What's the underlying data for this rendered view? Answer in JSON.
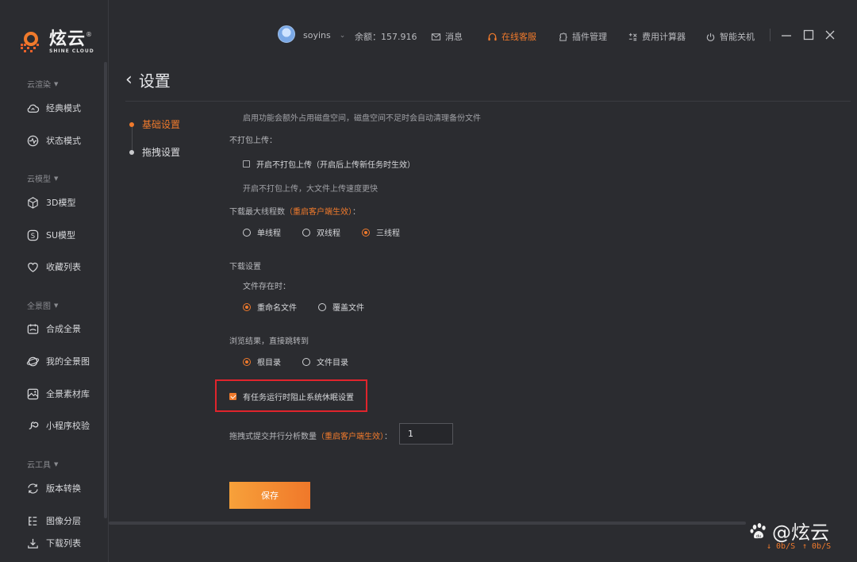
{
  "brand": {
    "name_cn": "炫云",
    "name_en": "SHINE CLOUD",
    "reg": "®"
  },
  "sidebar": {
    "groups": [
      {
        "label": "云渲染",
        "items": [
          {
            "label": "经典模式",
            "icon": "cloud-icon"
          },
          {
            "label": "状态模式",
            "icon": "status-icon"
          }
        ]
      },
      {
        "label": "云模型",
        "items": [
          {
            "label": "3D模型",
            "icon": "cube-icon"
          },
          {
            "label": "SU模型",
            "icon": "su-icon"
          },
          {
            "label": "收藏列表",
            "icon": "heart-icon"
          }
        ]
      },
      {
        "label": "全景图",
        "items": [
          {
            "label": "合成全景",
            "icon": "panorama-icon"
          },
          {
            "label": "我的全景图",
            "icon": "globe-icon"
          },
          {
            "label": "全景素材库",
            "icon": "image-library-icon"
          },
          {
            "label": "小程序校验",
            "icon": "miniprogram-icon"
          }
        ]
      },
      {
        "label": "云工具",
        "items": [
          {
            "label": "版本转换",
            "icon": "convert-icon"
          },
          {
            "label": "图像分层",
            "icon": "layers-icon"
          },
          {
            "label": "下载列表",
            "icon": "download-icon"
          }
        ]
      }
    ]
  },
  "topbar": {
    "username": "soyins",
    "balance_label": "余额：157.916",
    "messages": "消息",
    "support": "在线客服",
    "plugins": "插件管理",
    "calculator": "费用计算器",
    "shutdown": "智能关机"
  },
  "page": {
    "title": "设置"
  },
  "settings_nav": [
    {
      "label": "基础设置",
      "active": true
    },
    {
      "label": "拖拽设置",
      "active": false
    }
  ],
  "settings": {
    "backup_hint": "启用功能会额外占用磁盘空间，磁盘空间不足时会自动清理备份文件",
    "no_pack_title": "不打包上传：",
    "no_pack_option": "开启不打包上传（开启后上传新任务时生效）",
    "no_pack_hint": "开启不打包上传，大文件上传速度更快",
    "threads_title": "下载最大线程数",
    "threads_warn": "（重启客户端生效）",
    "threads_colon": "：",
    "threads_options": [
      "单线程",
      "双线程",
      "三线程"
    ],
    "threads_selected": "三线程",
    "download_title": "下载设置",
    "file_exists_title": "文件存在时：",
    "file_exists_options": [
      "重命名文件",
      "覆盖文件"
    ],
    "file_exists_selected": "重命名文件",
    "browse_title": "浏览结果，直接跳转到",
    "browse_options": [
      "根目录",
      "文件目录"
    ],
    "browse_selected": "根目录",
    "prevent_sleep": "有任务运行时阻止系统休眠设置",
    "parallel_title": "拖拽式提交并行分析数量",
    "parallel_warn": "（重启客户端生效）",
    "parallel_colon": "：",
    "parallel_value": "1",
    "save": "保存"
  },
  "footer": {
    "down_speed": "↓ 0b/S",
    "up_speed": "↑ 0b/S"
  },
  "watermark": "@炫云",
  "colors": {
    "accent": "#f07a2c",
    "background": "#2b2c30",
    "highlight": "#e0242c"
  }
}
